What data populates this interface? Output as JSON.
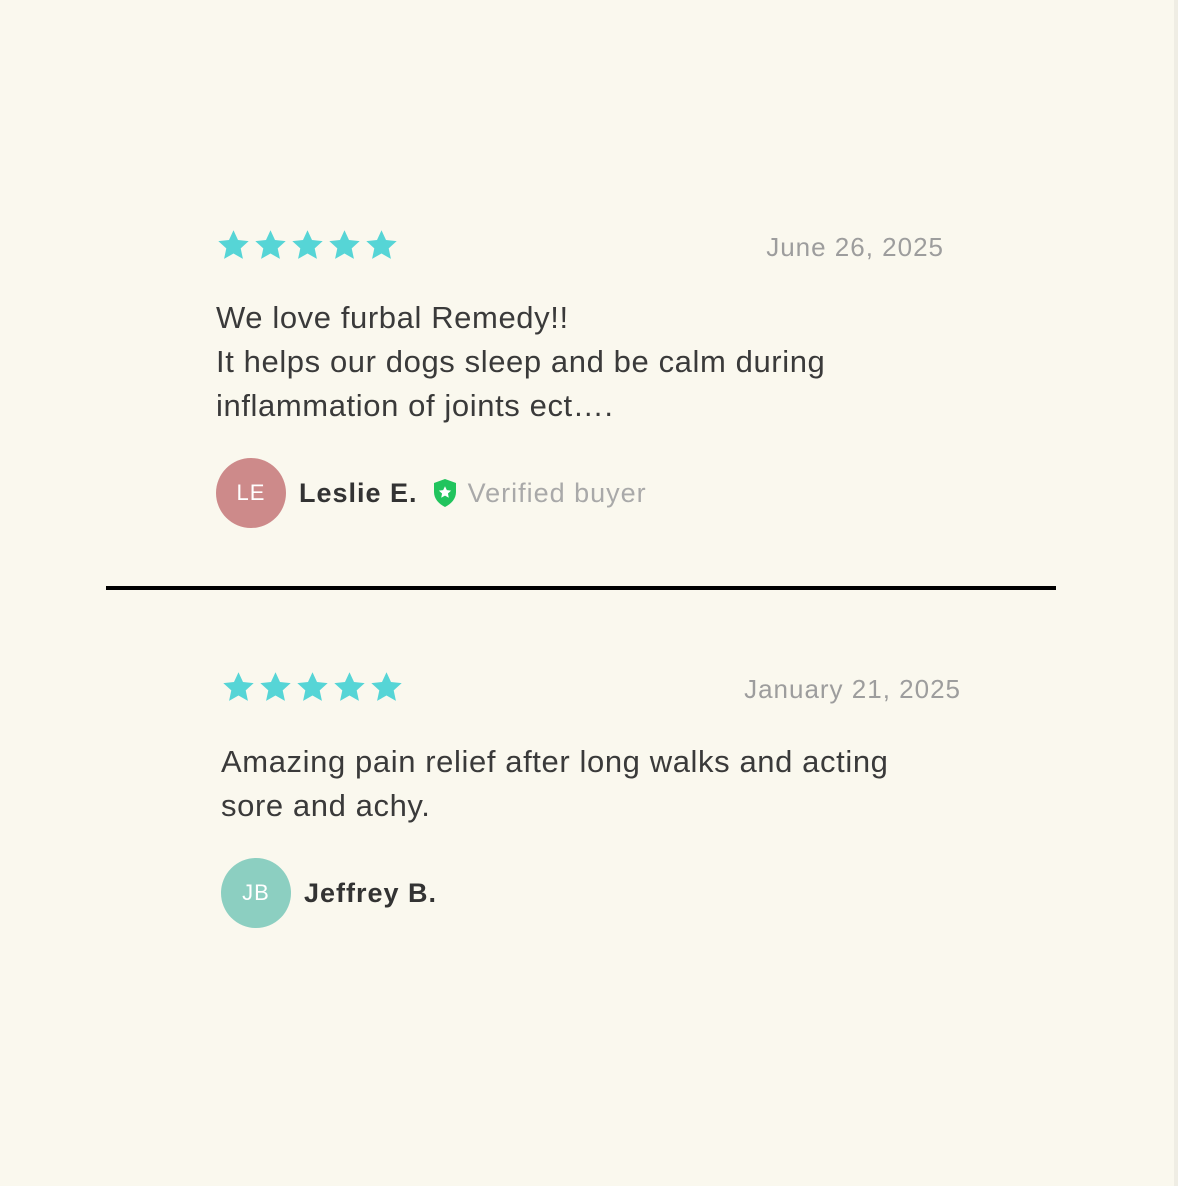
{
  "colors": {
    "background": "#faf8ee",
    "star": "#56d5d6",
    "verified": "#21c45d",
    "text": "#333333",
    "muted": "#9d9d9d",
    "divider": "#000000"
  },
  "reviews": [
    {
      "rating": 5,
      "max_rating": 5,
      "date": "June 26, 2025",
      "body_lines": [
        "We love furbal Remedy!!",
        "It helps our dogs sleep and be calm during",
        "inflammation of joints ect…."
      ],
      "author": {
        "initials": "LE",
        "name": "Leslie E.",
        "avatar_color": "#cd8a8a"
      },
      "verified": true,
      "verified_icon": "shield-star-icon",
      "verified_label": "Verified buyer"
    },
    {
      "rating": 5,
      "max_rating": 5,
      "date": "January 21, 2025",
      "body_lines": [
        "Amazing pain relief after long walks and acting",
        "sore and achy."
      ],
      "author": {
        "initials": "JB",
        "name": "Jeffrey B.",
        "avatar_color": "#8ccfc1"
      },
      "verified": false
    }
  ]
}
